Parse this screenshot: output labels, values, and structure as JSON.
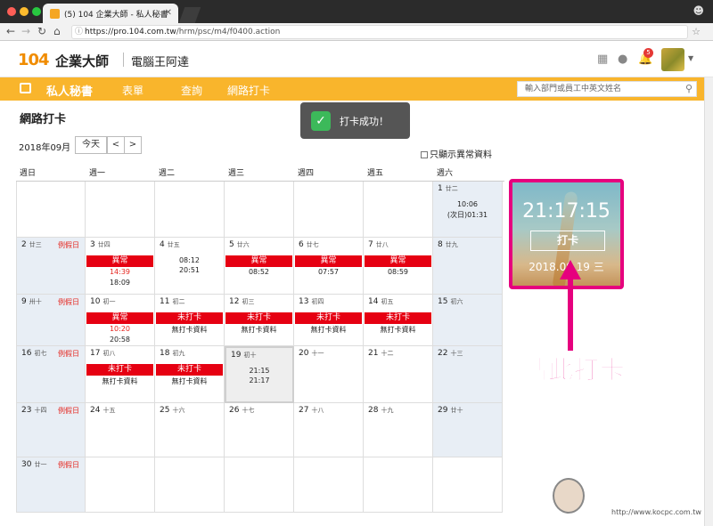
{
  "browser": {
    "tab_title": "(5) 104 企業大師 - 私人秘書",
    "url_host": "https://pro.104.com.tw",
    "url_path": "/hrm/psc/m4/f0400.action",
    "colors": {
      "close": "#ff5f57",
      "min": "#febc2e",
      "max": "#28c840"
    }
  },
  "header": {
    "logo": "104",
    "brand": "企業大師",
    "company": "電腦王阿達",
    "notification_count": "5"
  },
  "menu": {
    "items": [
      "私人秘書",
      "表單",
      "查詢",
      "網路打卡"
    ],
    "search_placeholder": "輸入部門或員工中英文姓名"
  },
  "page": {
    "title": "網路打卡",
    "toast": "打卡成功！",
    "month": "2018年09月",
    "today_btn": "今天",
    "prev_btn": "<",
    "next_btn": ">",
    "only_abnormal": "只顯示異常資料"
  },
  "calendar": {
    "weekdays": [
      "週日",
      "週一",
      "週二",
      "週三",
      "週四",
      "週五",
      "週六"
    ],
    "weeks": [
      [
        {
          "day": "",
          "lunar": ""
        },
        {
          "day": "",
          "lunar": ""
        },
        {
          "day": "",
          "lunar": ""
        },
        {
          "day": "",
          "lunar": ""
        },
        {
          "day": "",
          "lunar": ""
        },
        {
          "day": "",
          "lunar": ""
        },
        {
          "day": "1",
          "lunar": "廿二",
          "weekend": true,
          "plain": [
            "10:06",
            "(次日)01:31"
          ]
        }
      ],
      [
        {
          "day": "2",
          "lunar": "廿三",
          "weekend": true,
          "holiday": "例假日"
        },
        {
          "day": "3",
          "lunar": "廿四",
          "tag": "異常",
          "lines": [
            "14:39",
            "18:09"
          ],
          "red_first": true
        },
        {
          "day": "4",
          "lunar": "廿五",
          "plain": [
            "08:12",
            "20:51"
          ]
        },
        {
          "day": "5",
          "lunar": "廿六",
          "tag": "異常",
          "lines": [
            "08:52"
          ]
        },
        {
          "day": "6",
          "lunar": "廿七",
          "tag": "異常",
          "lines": [
            "07:57"
          ]
        },
        {
          "day": "7",
          "lunar": "廿八",
          "tag": "異常",
          "lines": [
            "08:59"
          ]
        },
        {
          "day": "8",
          "lunar": "廿九",
          "weekend": true
        }
      ],
      [
        {
          "day": "9",
          "lunar": "卅十",
          "weekend": true,
          "holiday": "例假日"
        },
        {
          "day": "10",
          "lunar": "初一",
          "tag": "異常",
          "lines": [
            "10:20",
            "20:58"
          ],
          "red_first": true
        },
        {
          "day": "11",
          "lunar": "初二",
          "tag": "未打卡",
          "lines": [
            "無打卡資料"
          ]
        },
        {
          "day": "12",
          "lunar": "初三",
          "tag": "未打卡",
          "lines": [
            "無打卡資料"
          ]
        },
        {
          "day": "13",
          "lunar": "初四",
          "tag": "未打卡",
          "lines": [
            "無打卡資料"
          ]
        },
        {
          "day": "14",
          "lunar": "初五",
          "tag": "未打卡",
          "lines": [
            "無打卡資料"
          ]
        },
        {
          "day": "15",
          "lunar": "初六",
          "weekend": true
        }
      ],
      [
        {
          "day": "16",
          "lunar": "初七",
          "weekend": true,
          "holiday": "例假日"
        },
        {
          "day": "17",
          "lunar": "初八",
          "tag": "未打卡",
          "lines": [
            "無打卡資料"
          ]
        },
        {
          "day": "18",
          "lunar": "初九",
          "tag": "未打卡",
          "lines": [
            "無打卡資料"
          ]
        },
        {
          "day": "19",
          "lunar": "初十",
          "today": true,
          "plain": [
            "21:15",
            "21:17"
          ]
        },
        {
          "day": "20",
          "lunar": "十一"
        },
        {
          "day": "21",
          "lunar": "十二"
        },
        {
          "day": "22",
          "lunar": "十三",
          "weekend": true
        }
      ],
      [
        {
          "day": "23",
          "lunar": "十四",
          "weekend": true,
          "holiday": "例假日"
        },
        {
          "day": "24",
          "lunar": "十五"
        },
        {
          "day": "25",
          "lunar": "十六"
        },
        {
          "day": "26",
          "lunar": "十七"
        },
        {
          "day": "27",
          "lunar": "十八"
        },
        {
          "day": "28",
          "lunar": "十九"
        },
        {
          "day": "29",
          "lunar": "廿十",
          "weekend": true
        }
      ],
      [
        {
          "day": "30",
          "lunar": "廿一",
          "weekend": true,
          "holiday": "例假日"
        },
        {
          "day": "",
          "lunar": ""
        },
        {
          "day": "",
          "lunar": ""
        },
        {
          "day": "",
          "lunar": ""
        },
        {
          "day": "",
          "lunar": ""
        },
        {
          "day": "",
          "lunar": ""
        },
        {
          "day": "",
          "lunar": ""
        }
      ]
    ]
  },
  "punch_widget": {
    "time": "21:17:15",
    "button": "打卡",
    "date": "2018.09.19 三"
  },
  "annotation": {
    "callout": "點此打卡",
    "color": "#e6007e"
  },
  "watermark": {
    "text": "電腦王阿達",
    "url": "http://www.kocpc.com.tw"
  }
}
